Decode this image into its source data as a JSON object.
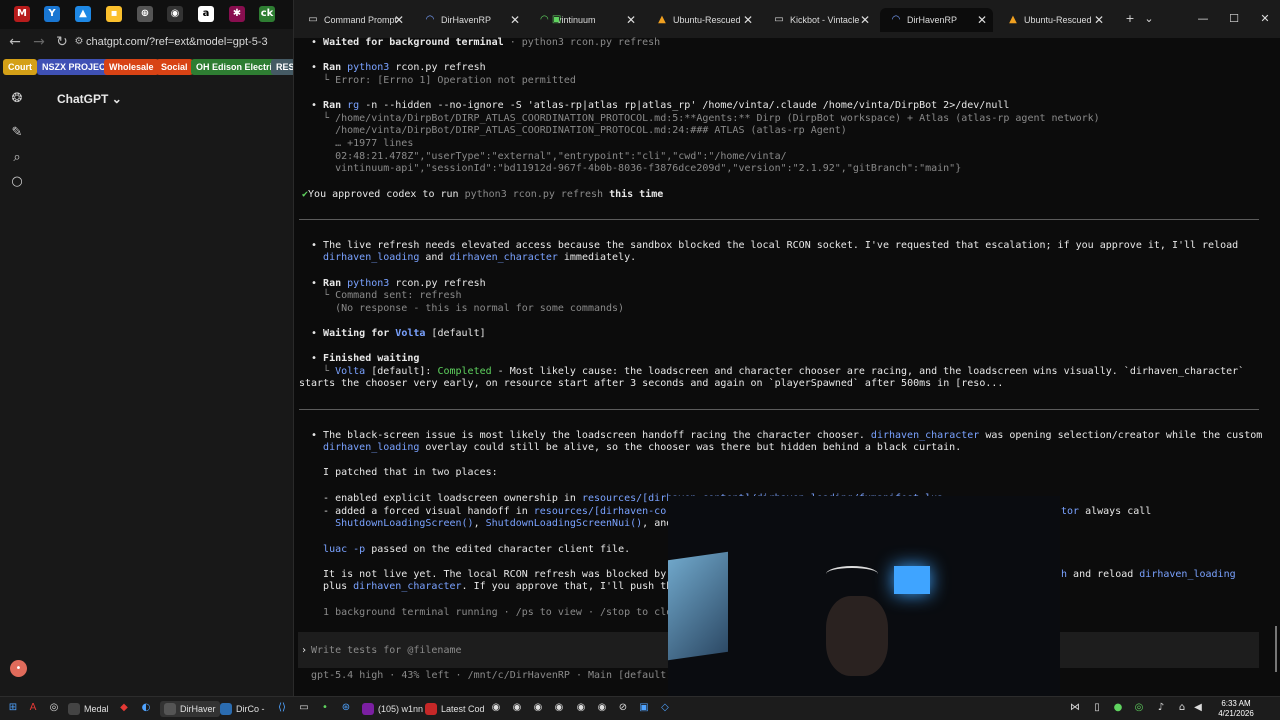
{
  "browser": {
    "url": "chatgpt.com/?ref=ext&model=gpt-5-3",
    "bookmarks": [
      {
        "label": "Court",
        "color": "#d4a017"
      },
      {
        "label": "NSZX PROJECT",
        "color": "#3f51b5"
      },
      {
        "label": "Wholesale",
        "color": "#d84315"
      },
      {
        "label": "Social",
        "color": "#d84315"
      },
      {
        "label": "OH Edison Electric",
        "color": "#2e7d32"
      },
      {
        "label": "RESE",
        "color": "#455a64"
      }
    ],
    "app_title": "ChatGPT",
    "avatar_initial": "•"
  },
  "terminal": {
    "tabs": [
      {
        "label": "Command Prompt",
        "icon": "terminal-icon"
      },
      {
        "label": "DirHavenRP",
        "icon": "spinner-icon"
      },
      {
        "label": "vintinuum",
        "icon": "green-square-icon"
      },
      {
        "label": "Ubuntu-Rescued",
        "icon": "linux-icon"
      },
      {
        "label": "Kickbot - Vintacle",
        "icon": "terminal-icon"
      },
      {
        "label": "DirHavenRP",
        "icon": "spinner-icon"
      },
      {
        "label": "Ubuntu-Rescued",
        "icon": "linux-icon"
      }
    ],
    "lines": {
      "l1a": "• ",
      "l1b": "Waited for background terminal",
      "l1c": " · python3 rcon.py refresh",
      "l2a": "• ",
      "l2b": "Ran ",
      "l2c": "python3",
      "l2d": " rcon.py refresh",
      "l3": "  └ Error: [Errno 1] Operation not permitted",
      "l4a": "• ",
      "l4b": "Ran ",
      "l4c": "rg",
      "l4d": " -n --hidden --no-ignore -S ",
      "l4e": "'atlas-rp|atlas rp|atlas_rp'",
      "l4f": " /home/vinta/.claude /home/vinta/DirpBot 2>/dev/null",
      "l5": "  └ /home/vinta/DirpBot/DIRP_ATLAS_COORDINATION_PROTOCOL.md:5:**Agents:** Dirp (DirpBot workspace) + Atlas (atlas-rp agent network)",
      "l6": "    /home/vinta/DirpBot/DIRP_ATLAS_COORDINATION_PROTOCOL.md:24:### ATLAS (atlas-rp Agent)",
      "l7": "    … +1977 lines",
      "l8": "    02:48:21.478Z\",\"userType\":\"external\",\"entrypoint\":\"cli\",\"cwd\":\"/home/vinta/",
      "l9": "    vintinuum-api\",\"sessionId\":\"bd11912d-967f-4b0b-8036-f3876dce209d\",\"version\":\"2.1.92\",\"gitBranch\":\"main\"}",
      "l10a": "✔",
      "l10b": "You approved codex to run ",
      "l10c": "python3 rcon.py refresh",
      "l10d": " this time",
      "l11a": "• ",
      "l11b": "The live refresh needs elevated access because the sandbox blocked the local RCON socket. I've requested that escalation; if you approve it, I'll reload",
      "l12a": "  ",
      "l12b": "dirhaven_loading",
      "l12c": " and ",
      "l12d": "dirhaven_character",
      "l12e": " immediately.",
      "l13a": "• ",
      "l13b": "Ran ",
      "l13c": "python3",
      "l13d": " rcon.py refresh",
      "l14": "  └ Command sent: refresh",
      "l15": "    (No response - this is normal for some commands)",
      "l16a": "• ",
      "l16b": "Waiting for ",
      "l16c": "Volta",
      "l16d": " [default]",
      "l17a": "• ",
      "l17b": "Finished waiting",
      "l18a": "  └ ",
      "l18b": "Volta",
      "l18c": " [default]: ",
      "l18d": "Completed",
      "l18e": " - Most likely cause: the loadscreen and character chooser are racing, and the loadscreen wins visually. `dirhaven_character`",
      "l19": "starts the chooser very early, on resource start after 3 seconds and again on `playerSpawned` after 500ms in [reso...",
      "l20a": "• ",
      "l20b": "The black-screen issue is most likely the loadscreen handoff racing the character chooser. ",
      "l20c": "dirhaven_character",
      "l20d": " was opening selection/creator while the custom",
      "l21a": "  ",
      "l21b": "dirhaven_loading",
      "l21c": " overlay could still be alive, so the chooser was there but hidden behind a black curtain.",
      "l22": "  I patched that in two places:",
      "l23a": "  - enabled explicit loadscreen ownership in ",
      "l23b": "resources/[dirhaven-content]/dirhaven_loading/fxmanifest.lua",
      "l24a": "  - added a forced visual handoff in ",
      "l24b": "resources/[dirhaven-core]",
      "l24c": "tor",
      "l24d": " always call",
      "l25a": "    ",
      "l25b": "ShutdownLoadingScreen()",
      "l25c": ", ",
      "l25d": "ShutdownLoadingScreenNui()",
      "l25e": ", and t",
      "l26a": "  ",
      "l26b": "luac -p",
      "l26c": " passed on the edited character client file.",
      "l27a": "  It is not live yet. The local RCON refresh was blocked by th",
      "l27b": "h",
      "l27c": " and reload ",
      "l27d": "dirhaven_loading",
      "l28a": "  plus ",
      "l28b": "dirhaven_character",
      "l28c": ". If you approve that, I'll push the",
      "l29": "  1 background terminal running · /ps to view · /stop to close",
      "prompt_marker": "›",
      "prompt_placeholder": "Write tests for @filename",
      "status": "  gpt-5.4 high · 43% left · /mnt/c/DirHavenRP · Main [default]"
    }
  },
  "taskbar": {
    "apps": [
      {
        "label": "Medal",
        "color": "#444"
      },
      {
        "label": "DirHaver",
        "color": "#333"
      },
      {
        "label": "DirCo -",
        "color": "#2b6cb0"
      },
      {
        "label": "(105) w1nn",
        "color": "#7b1fa2"
      },
      {
        "label": "Latest Cod",
        "color": "#c62828"
      }
    ],
    "time": "6:33 AM",
    "date": "4/21/2026"
  }
}
